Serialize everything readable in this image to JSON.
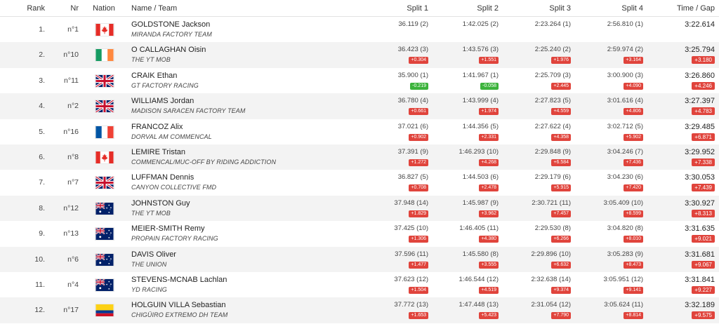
{
  "headers": {
    "rank": "Rank",
    "nr": "Nr",
    "nation": "Nation",
    "name_team": "Name / Team",
    "split1": "Split 1",
    "split2": "Split 2",
    "split3": "Split 3",
    "split4": "Split 4",
    "time_gap": "Time / Gap"
  },
  "colors": {
    "gap_positive": "#e0443c",
    "gap_negative": "#3bb33b",
    "zebra": "#f3f3f3"
  },
  "riders": [
    {
      "rank": "1.",
      "nr": "n°1",
      "nation": "CAN",
      "flag": "canada-flag-icon",
      "name": "GOLDSTONE Jackson",
      "team": "MIRANDA FACTORY TEAM",
      "s1": "36.119 (2)",
      "s1g": "",
      "s2": "1:42.025 (2)",
      "s2g": "",
      "s3": "2:23.264 (1)",
      "s3g": "",
      "s4": "2:56.810 (1)",
      "s4g": "",
      "time": "3:22.614",
      "gap": ""
    },
    {
      "rank": "2.",
      "nr": "n°10",
      "nation": "IRL",
      "flag": "ireland-flag-icon",
      "name": "O CALLAGHAN Oisin",
      "team": "THE YT MOB",
      "s1": "36.423 (3)",
      "s1g": "+0.304",
      "s2": "1:43.576 (3)",
      "s2g": "+1.551",
      "s3": "2:25.240 (2)",
      "s3g": "+1.976",
      "s4": "2:59.974 (2)",
      "s4g": "+3.164",
      "time": "3:25.794",
      "gap": "+3.180"
    },
    {
      "rank": "3.",
      "nr": "n°11",
      "nation": "GBR",
      "flag": "great-britain-flag-icon",
      "name": "CRAIK Ethan",
      "team": "GT FACTORY RACING",
      "s1": "35.900 (1)",
      "s1g": "-0.219",
      "s2": "1:41.967 (1)",
      "s2g": "-0.058",
      "s3": "2:25.709 (3)",
      "s3g": "+2.445",
      "s4": "3:00.900 (3)",
      "s4g": "+4.090",
      "time": "3:26.860",
      "gap": "+4.246"
    },
    {
      "rank": "4.",
      "nr": "n°2",
      "nation": "GBR",
      "flag": "great-britain-flag-icon",
      "name": "WILLIAMS Jordan",
      "team": "MADISON SARACEN FACTORY TEAM",
      "s1": "36.780 (4)",
      "s1g": "+0.661",
      "s2": "1:43.999 (4)",
      "s2g": "+1.974",
      "s3": "2:27.823 (5)",
      "s3g": "+4.559",
      "s4": "3:01.616 (4)",
      "s4g": "+4.806",
      "time": "3:27.397",
      "gap": "+4.783"
    },
    {
      "rank": "5.",
      "nr": "n°16",
      "nation": "FRA",
      "flag": "france-flag-icon",
      "name": "FRANCOZ Alix",
      "team": "DORVAL AM COMMENCAL",
      "s1": "37.021 (6)",
      "s1g": "+0.902",
      "s2": "1:44.356 (5)",
      "s2g": "+2.331",
      "s3": "2:27.622 (4)",
      "s3g": "+4.358",
      "s4": "3:02.712 (5)",
      "s4g": "+5.902",
      "time": "3:29.485",
      "gap": "+6.871"
    },
    {
      "rank": "6.",
      "nr": "n°8",
      "nation": "CAN",
      "flag": "canada-flag-icon",
      "name": "LEMIRE Tristan",
      "team": "COMMENCAL/MUC-OFF BY RIDING ADDICTION",
      "s1": "37.391 (9)",
      "s1g": "+1.272",
      "s2": "1:46.293 (10)",
      "s2g": "+4.268",
      "s3": "2:29.848 (9)",
      "s3g": "+6.584",
      "s4": "3:04.246 (7)",
      "s4g": "+7.436",
      "time": "3:29.952",
      "gap": "+7.338"
    },
    {
      "rank": "7.",
      "nr": "n°7",
      "nation": "GBR",
      "flag": "great-britain-flag-icon",
      "name": "LUFFMAN Dennis",
      "team": "CANYON COLLECTIVE FMD",
      "s1": "36.827 (5)",
      "s1g": "+0.708",
      "s2": "1:44.503 (6)",
      "s2g": "+2.478",
      "s3": "2:29.179 (6)",
      "s3g": "+5.915",
      "s4": "3:04.230 (6)",
      "s4g": "+7.420",
      "time": "3:30.053",
      "gap": "+7.439"
    },
    {
      "rank": "8.",
      "nr": "n°12",
      "nation": "AUS",
      "flag": "australia-flag-icon",
      "name": "JOHNSTON Guy",
      "team": "THE YT MOB",
      "s1": "37.948 (14)",
      "s1g": "+1.829",
      "s2": "1:45.987 (9)",
      "s2g": "+3.962",
      "s3": "2:30.721 (11)",
      "s3g": "+7.457",
      "s4": "3:05.409 (10)",
      "s4g": "+8.599",
      "time": "3:30.927",
      "gap": "+8.313"
    },
    {
      "rank": "9.",
      "nr": "n°13",
      "nation": "AUS",
      "flag": "australia-flag-icon",
      "name": "MEIER-SMITH Remy",
      "team": "PROPAIN FACTORY RACING",
      "s1": "37.425 (10)",
      "s1g": "+1.306",
      "s2": "1:46.405 (11)",
      "s2g": "+4.380",
      "s3": "2:29.530 (8)",
      "s3g": "+6.266",
      "s4": "3:04.820 (8)",
      "s4g": "+8.010",
      "time": "3:31.635",
      "gap": "+9.021"
    },
    {
      "rank": "10.",
      "nr": "n°6",
      "nation": "AUS",
      "flag": "australia-flag-icon",
      "name": "DAVIS Oliver",
      "team": "THE UNION",
      "s1": "37.596 (11)",
      "s1g": "+1.477",
      "s2": "1:45.580 (8)",
      "s2g": "+3.555",
      "s3": "2:29.896 (10)",
      "s3g": "+6.632",
      "s4": "3:05.283 (9)",
      "s4g": "+8.473",
      "time": "3:31.681",
      "gap": "+9.067"
    },
    {
      "rank": "11.",
      "nr": "n°4",
      "nation": "AUS",
      "flag": "australia-flag-icon",
      "name": "STEVENS-MCNAB Lachlan",
      "team": "YD RACING",
      "s1": "37.623 (12)",
      "s1g": "+1.504",
      "s2": "1:46.544 (12)",
      "s2g": "+4.519",
      "s3": "2:32.638 (14)",
      "s3g": "+9.374",
      "s4": "3:05.951 (12)",
      "s4g": "+9.141",
      "time": "3:31.841",
      "gap": "+9.227"
    },
    {
      "rank": "12.",
      "nr": "n°17",
      "nation": "COL",
      "flag": "colombia-flag-icon",
      "name": "HOLGUIN VILLA Sebastian",
      "team": "CHIGÜIRO EXTREMO DH TEAM",
      "s1": "37.772 (13)",
      "s1g": "+1.653",
      "s2": "1:47.448 (13)",
      "s2g": "+5.423",
      "s3": "2:31.054 (12)",
      "s3g": "+7.790",
      "s4": "3:05.624 (11)",
      "s4g": "+8.814",
      "time": "3:32.189",
      "gap": "+9.575"
    }
  ]
}
